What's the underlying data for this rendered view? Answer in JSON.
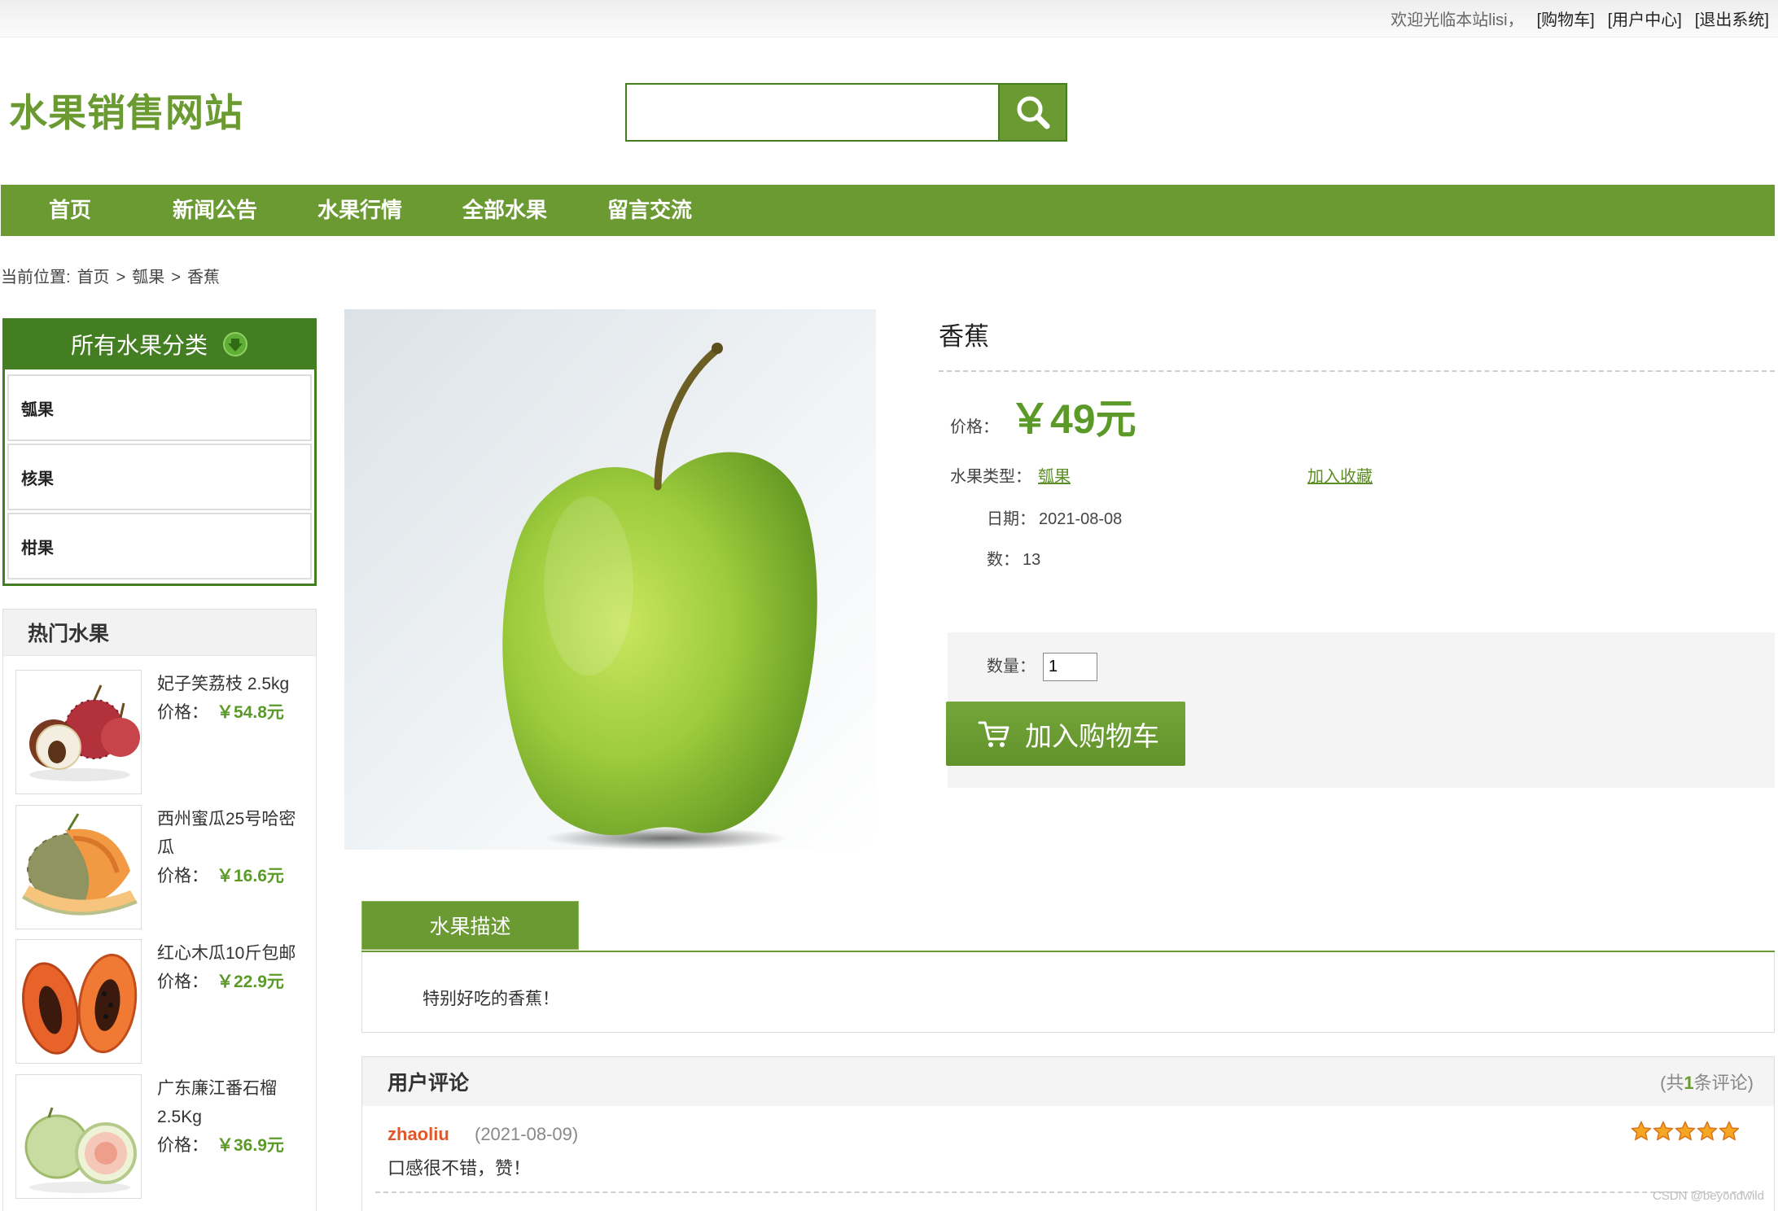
{
  "topbar": {
    "welcome": "欢迎光临本站lisi，",
    "links": [
      "[购物车]",
      "[用户中心]",
      "[退出系统]"
    ]
  },
  "header": {
    "logo": "水果销售网站",
    "search": {
      "placeholder": "",
      "value": ""
    }
  },
  "nav": {
    "items": [
      "首页",
      "新闻公告",
      "水果行情",
      "全部水果",
      "留言交流"
    ]
  },
  "breadcrumb": {
    "prefix": "当前位置:",
    "separator": ">",
    "items": [
      "首页",
      "瓠果",
      "香蕉"
    ]
  },
  "sidebar": {
    "category_title": "所有水果分类",
    "categories": [
      "瓠果",
      "核果",
      "柑果"
    ],
    "hot_title": "热门水果",
    "hot_items": [
      {
        "name": "妃子笑荔枝 2.5kg",
        "price_label": "价格：",
        "price": "￥54.8元"
      },
      {
        "name": "西州蜜瓜25号哈密瓜",
        "price_label": "价格：",
        "price": "￥16.6元"
      },
      {
        "name": "红心木瓜10斤包邮",
        "price_label": "价格：",
        "price": "￥22.9元"
      },
      {
        "name": "广东廉江番石榴2.5Kg",
        "price_label": "价格：",
        "price": "￥36.9元"
      }
    ]
  },
  "product": {
    "name": "香蕉",
    "price_label": "价格：",
    "price": "￥49元",
    "type_label": "水果类型：",
    "type": "瓠果",
    "favorite": "加入收藏",
    "date_label": "日期：",
    "date": "2021-08-08",
    "stock_label": "数：",
    "stock": "13",
    "qty_label": "数量：",
    "qty_value": "1",
    "add_to_cart": "加入购物车"
  },
  "description": {
    "tab": "水果描述",
    "text": "特别好吃的香蕉！"
  },
  "comments": {
    "title": "用户评论",
    "count_prefix": "(共",
    "count": "1",
    "count_suffix": "条评论)",
    "items": [
      {
        "user": "zhaoliu",
        "date": "(2021-08-09)",
        "rating": 5,
        "text": "口感很不错，赞！"
      }
    ]
  },
  "watermark": "CSDN @beyondwild",
  "icons": {
    "search": "search-icon",
    "category": "chevron-down-circle-icon",
    "cart": "cart-icon",
    "rating": "star-icon"
  },
  "colors": {
    "brand": "#6b9a33",
    "brand_dark": "#437f22",
    "price": "#5b9a28",
    "link": "#5b8f25",
    "user": "#e0572a",
    "star": "#f5a623"
  }
}
